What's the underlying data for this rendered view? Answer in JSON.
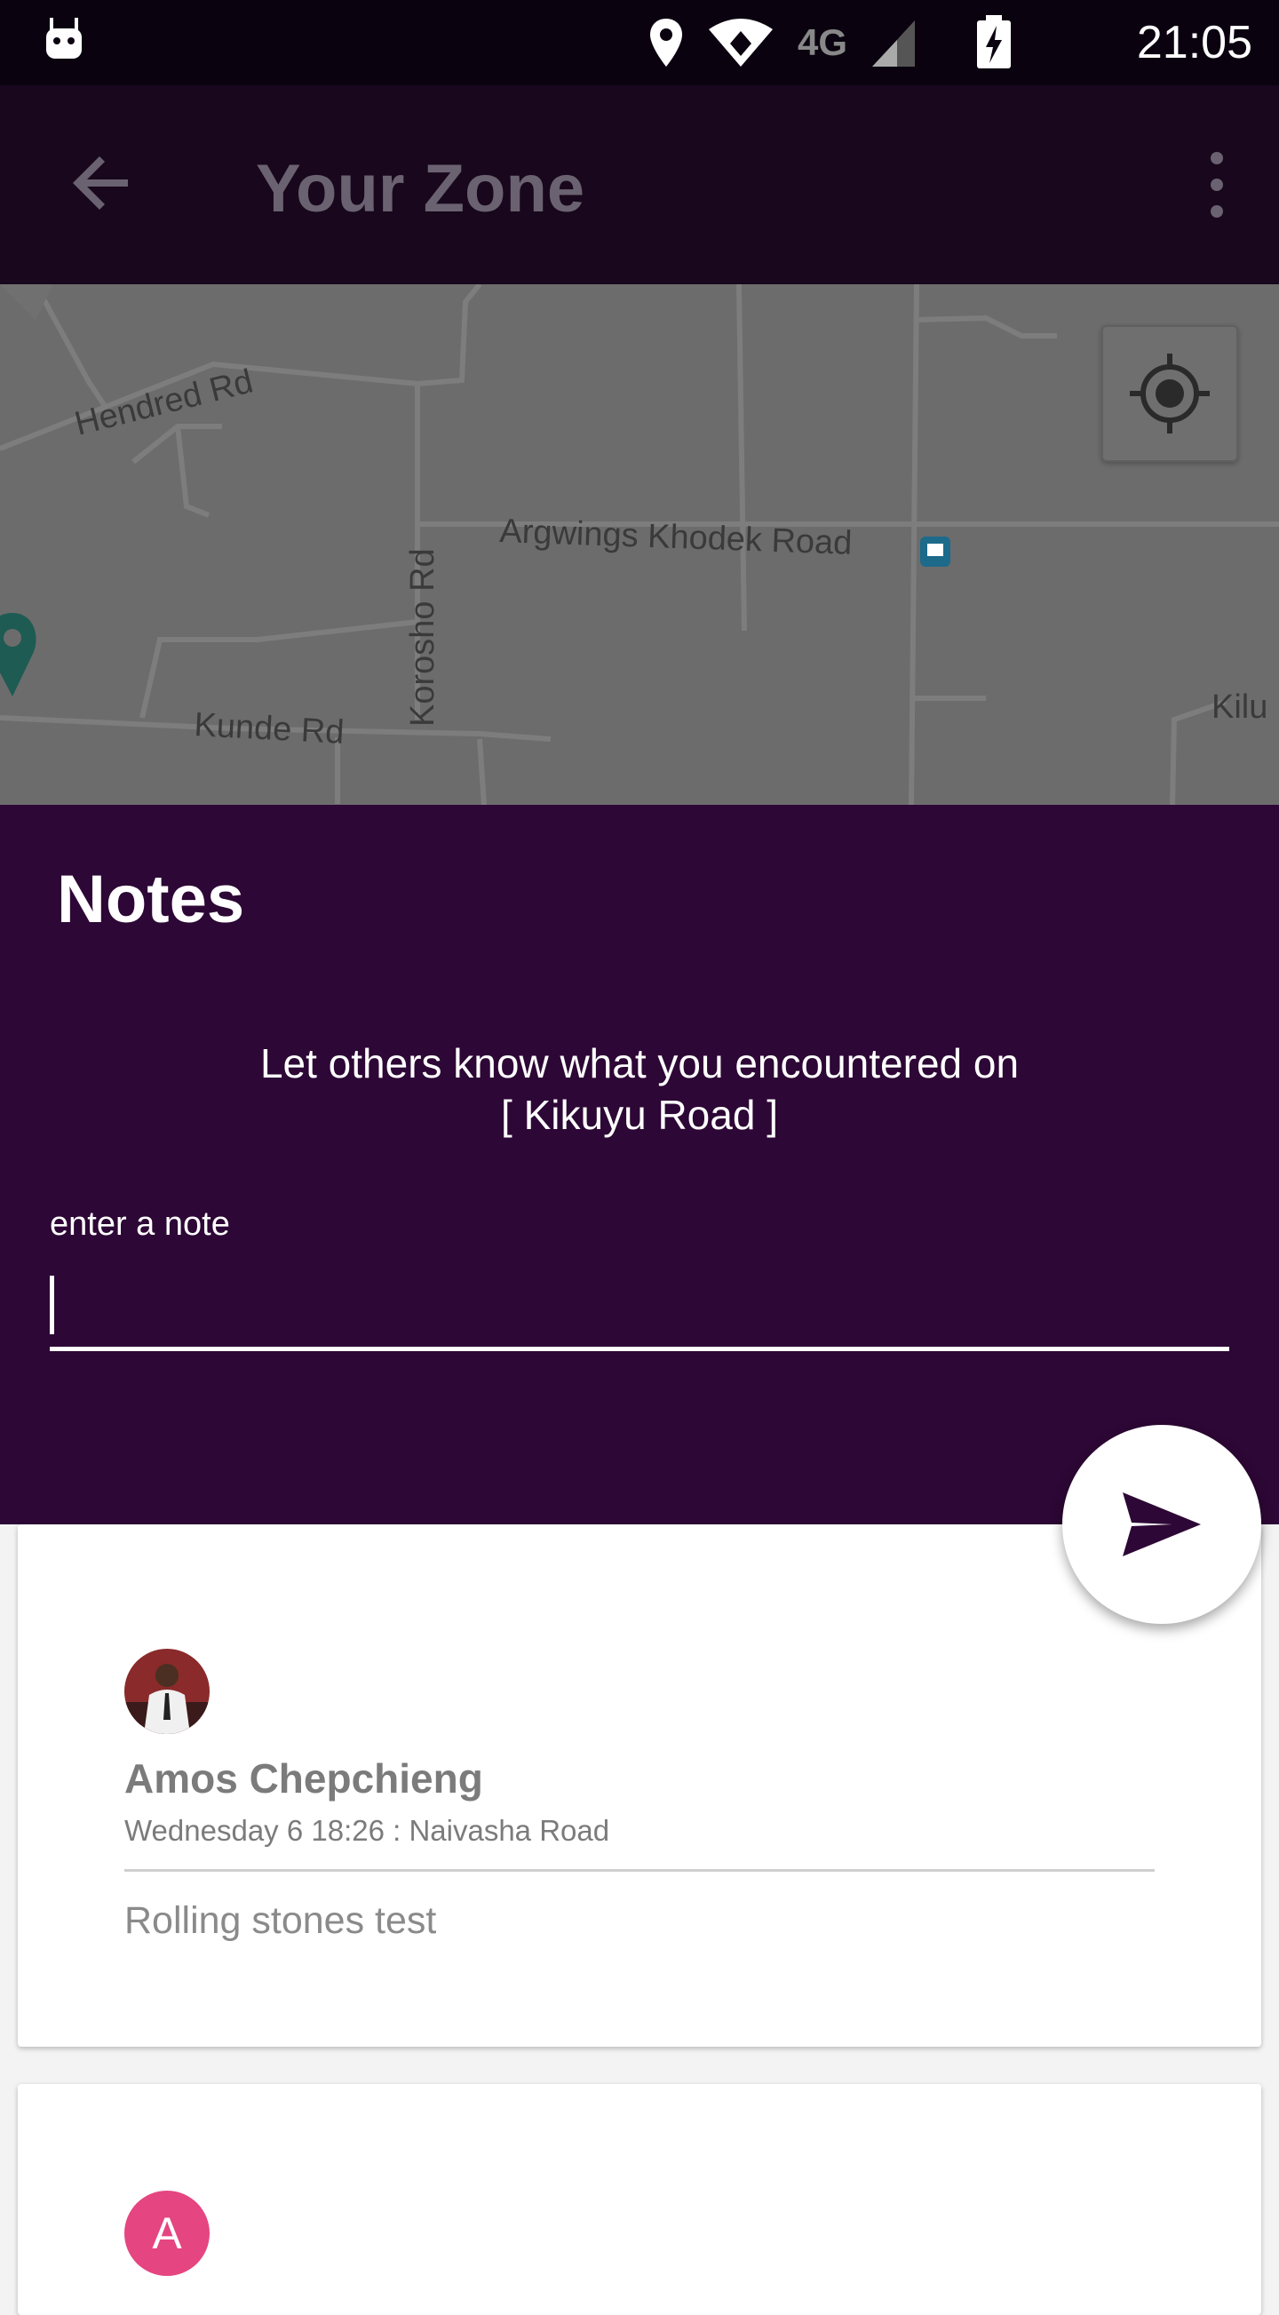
{
  "status_bar": {
    "time": "21:05",
    "icons": [
      "android-icon",
      "location-icon",
      "wifi-icon",
      "4g-lte-icon",
      "signal-icon",
      "battery-charging-icon"
    ],
    "network_label": "4G"
  },
  "app_bar": {
    "title": "Your Zone",
    "back_icon": "arrow-back-icon",
    "menu_icon": "more-vert-icon"
  },
  "map": {
    "labels": {
      "hendred": "Hendred Rd",
      "argwings": "Argwings Khodek Road",
      "korosho": "Korosho Rd",
      "kunde": "Kunde Rd",
      "kilu": "Kilu"
    },
    "locate_icon": "my-location-icon"
  },
  "notes": {
    "heading": "Notes",
    "prompt_line1": "Let others know what you encountered on",
    "prompt_line2": "[ Kikuyu Road ]",
    "input_label": "enter a note",
    "input_value": "",
    "send_icon": "send-icon"
  },
  "cards": [
    {
      "author": "Amos Chepchieng",
      "meta": "Wednesday 6  18:26 : Naivasha Road",
      "text": "Rolling stones test"
    },
    {
      "avatar_letter": "A"
    }
  ],
  "colors": {
    "status_bar": "#0b0210",
    "app_bar": "#18071d",
    "notes_bg": "#2d0735",
    "accent_avatar": "#e54580"
  }
}
